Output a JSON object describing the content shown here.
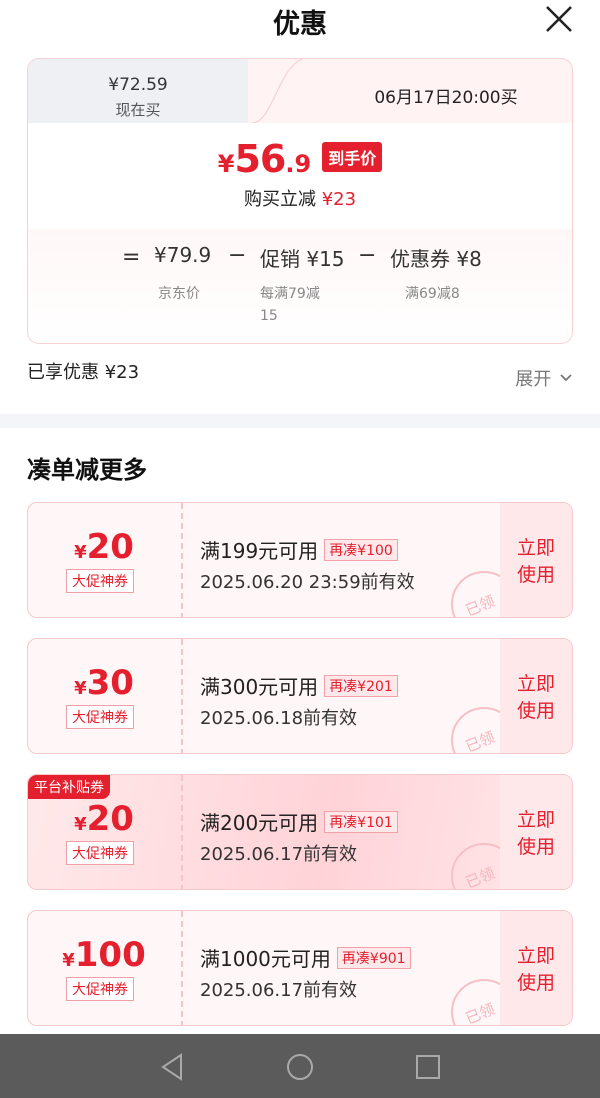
{
  "header": {
    "title": "优惠"
  },
  "price_card": {
    "tab_now_price": "¥72.59",
    "tab_now_label": "现在买",
    "tab_later": "06月17日20:00买",
    "final_price_yen": "¥",
    "final_price_int": "56",
    "final_price_dec": ".9",
    "final_badge": "到手价",
    "reduce_label": "购买立减",
    "reduce_amount": "¥23",
    "formula": {
      "eq": "=",
      "jd_price": "¥79.9",
      "jd_label": "京东价",
      "minus1": "−",
      "promo": "促销 ¥15",
      "promo_desc_1": "每满79减",
      "promo_desc_2": "15",
      "minus2": "−",
      "coupon": "优惠券 ¥8",
      "coupon_desc": "满69减8"
    }
  },
  "enjoyed": "已享优惠 ¥23",
  "expand_label": "展开",
  "section_title": "凑单减更多",
  "coupons": [
    {
      "yen": "¥",
      "amount": "20",
      "tag": "大促神券",
      "condition": "满199元可用",
      "extra": "再凑¥100",
      "date": "2025.06.20 23:59前有效",
      "use": "立即",
      "use2": "使用",
      "stamp": "已领"
    },
    {
      "yen": "¥",
      "amount": "30",
      "tag": "大促神券",
      "condition": "满300元可用",
      "extra": "再凑¥201",
      "date": "2025.06.18前有效",
      "use": "立即",
      "use2": "使用",
      "stamp": "已领"
    },
    {
      "yen": "¥",
      "amount": "20",
      "tag": "大促神券",
      "condition": "满200元可用",
      "extra": "再凑¥101",
      "date": "2025.06.17前有效",
      "use": "立即",
      "use2": "使用",
      "stamp": "已领",
      "badge": "平台补贴券"
    },
    {
      "yen": "¥",
      "amount": "100",
      "tag": "大促神券",
      "condition": "满1000元可用",
      "extra": "再凑¥901",
      "date": "2025.06.17前有效",
      "use": "立即",
      "use2": "使用",
      "stamp": "已领"
    }
  ],
  "colors": {
    "accent": "#e4202f",
    "navbar": "#5b5b5b"
  }
}
